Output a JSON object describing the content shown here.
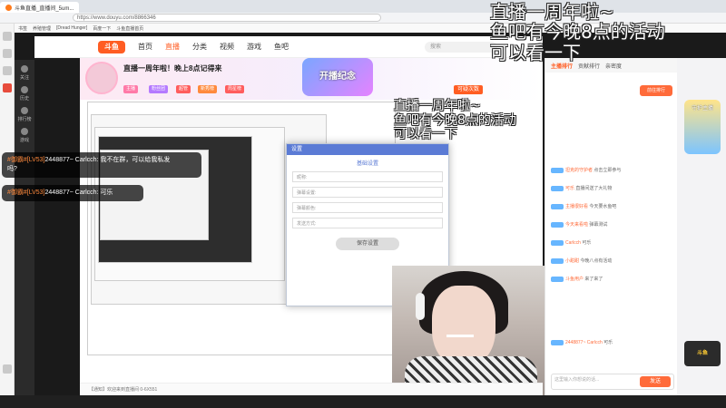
{
  "browser": {
    "tab_title": "斗鱼直播_直播间_5um...",
    "url": "https://www.douyu.com/8866346",
    "bookmarks": [
      "书签",
      "养殖管理",
      "[Dread Hunger]",
      "百度一下",
      "斗鱼直播首页"
    ]
  },
  "site": {
    "logo": "斗鱼",
    "nav": [
      "首页",
      "直播",
      "分类",
      "视频",
      "游戏",
      "鱼吧"
    ],
    "active_nav": "直播",
    "search_placeholder": "搜索",
    "left_rail": [
      "关注",
      "历史",
      "排行榜",
      "游戏"
    ]
  },
  "room": {
    "title": "直播一周年啦！晚上8点记得来",
    "subscribe_label": "可疑次数",
    "anniversary_label": "开播纪念",
    "tags": [
      "主播",
      "粉丝团",
      "超管",
      "新秀榜",
      "周星榜"
    ]
  },
  "overlay": {
    "big_lines": "直播一周年啦~\n鱼吧有今晚8点的活动\n可以看一下",
    "small_lines": "直播一周年啦~\n鱼吧有今晚8点的活动\n可以看一下"
  },
  "chat_bubbles": [
    {
      "level": "#御霸#[LV53]",
      "user": "2448877~ Carlcch:",
      "text": "我不在群，可以给我私发",
      "text2": "吗?"
    },
    {
      "level": "#御霸#[LV53]",
      "user": "2448877~ Carlcch:",
      "text": "可乐"
    }
  ],
  "dialog": {
    "title": "设置",
    "header": "基础设置",
    "fields": [
      "昵称:",
      "弹幕设置:",
      "弹幕颜色:",
      "发送方式:"
    ],
    "button": "保存设置"
  },
  "chat_panel": {
    "tabs": [
      "主播排行",
      "贡献排行",
      "亲密度"
    ],
    "active_tab": "主播排行",
    "rank_button": "前往排行",
    "rows": [
      {
        "user": "坦克的守护者",
        "text": "点击立即参与"
      },
      {
        "user": "可乐",
        "text": "直播间送了大礼物"
      },
      {
        "user": "主播很好看",
        "text": "今天要水鱼吧"
      },
      {
        "user": "今天来看啦",
        "text": "弹幕测试"
      },
      {
        "user": "Carlcch",
        "text": "可乐"
      },
      {
        "user": "小甜甜",
        "text": "今晚八点有活动"
      },
      {
        "user": "斗鱼用户",
        "text": "来了来了"
      },
      {
        "user": "2448877~ Carlcch",
        "text": "可乐"
      }
    ],
    "input_placeholder": "这里输入你想说的话...",
    "send_label": "发送"
  },
  "right_strip": {
    "gift_label": "守护主播",
    "card_label": "斗鱼"
  },
  "bottom_bar": "【通知】欢迎来到直播间 0-6X551"
}
